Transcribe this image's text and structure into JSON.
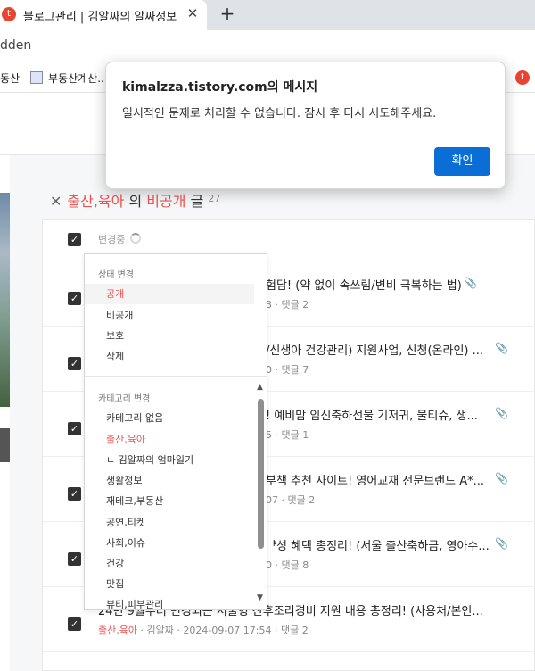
{
  "browser": {
    "tab_title": "블로그관리 | 김알짜의 알짜정보",
    "tab_close": "✕",
    "new_tab": "+",
    "url_fragment": "dden",
    "bookmarks": [
      "동산",
      "부동산계산..."
    ]
  },
  "dialog": {
    "title": "kimalzza.tistory.com의 메시지",
    "message": "일시적인 문제로 처리할 수 없습니다. 잠시 후 다시 시도해주세요.",
    "ok_label": "확인"
  },
  "heading": {
    "close": "✕",
    "category": "출산,육아",
    "of": " 의 ",
    "visibility": "비공개",
    "suffix": " 글 ",
    "count": "27"
  },
  "list_header": {
    "status": "변경중"
  },
  "dropdown": {
    "status_section": "상태 변경",
    "status_items": [
      "공개",
      "비공개",
      "보호",
      "삭제"
    ],
    "category_section": "카테고리 변경",
    "category_items": [
      "카테고리 없음",
      "출산,육아",
      "ㄴ 김알짜의 엄마일기",
      "생활정보",
      "재테크,부동산",
      "공연,티켓",
      "사회,이슈",
      "건강",
      "맛집",
      "뷰티,피부관리"
    ],
    "scroll_up": "▲",
    "scroll_down": "▼"
  },
  "rows": [
    {
      "title": "험담! (약 없이 속쓰림/변비 극복하는 법)",
      "meta_tail": "3 · 댓글 2"
    },
    {
      "title": "/신생아 건강관리) 지원사업, 신청(온라인) ...",
      "meta_tail": "0 · 댓글 7"
    },
    {
      "title": "! 예비맘 임신축하선물 기저귀, 물티슈, 생...",
      "meta_tail": "5 · 댓글 1"
    },
    {
      "title": "부책 추천 사이트! 영어교재 전문브랜드 A*...",
      "meta_tail": "07 · 댓글 2"
    },
    {
      "title": "ᅣ성 혜택 총정리! (서울 출산축하금, 영아수...",
      "meta_tail": "0 · 댓글 8"
    },
    {
      "title": "24년 9월부터 변경되는 서울형 산후조리경비 지원 내용 총정리! (사용처/본인...",
      "category": "출산,육아",
      "author": "김알짜",
      "date": "2024-09-07 17:54",
      "comments": "댓글 2"
    }
  ],
  "colors": {
    "accent": "#ef5350",
    "button": "#0b6ed6"
  }
}
